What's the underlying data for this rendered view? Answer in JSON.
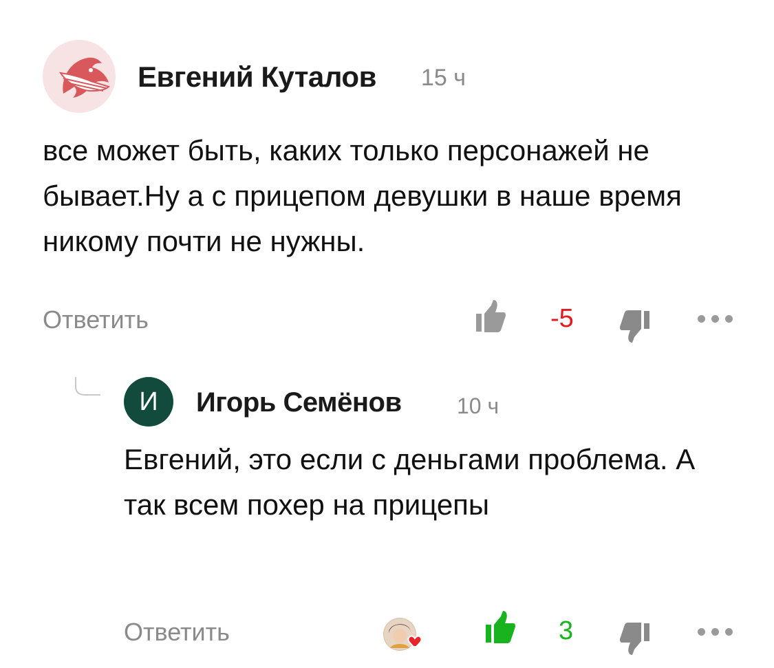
{
  "comments": [
    {
      "author": "Евгений Куталов",
      "time": "15 ч",
      "text": "все может быть, каких только персонажей не бывает.Ну а с прицепом девушки в наше время никому почти не нужны.",
      "reply_label": "Ответить",
      "rating": "-5",
      "rating_color": "#e8191e",
      "avatar_icon": "dolphin-mask-icon"
    },
    {
      "author": "Игорь Семёнов",
      "avatar_letter": "И",
      "avatar_color": "#124a3b",
      "time": "10 ч",
      "text": "Евгений, это если с деньгами проблема. А так всем похер на прицепы",
      "reply_label": "Ответить",
      "rating": "3",
      "rating_color": "#19b31f",
      "liker_icon": "liked-by-avatar-heart-icon"
    }
  ]
}
